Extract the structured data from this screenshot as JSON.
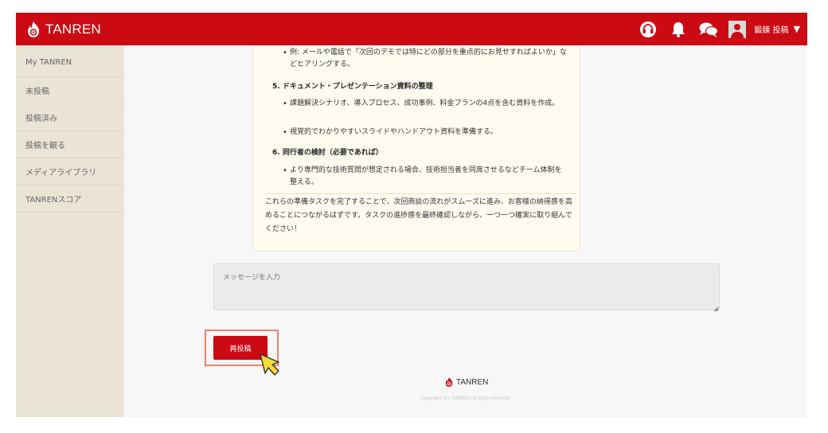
{
  "header": {
    "brand": "TANREN",
    "username": "鍛錬 投稿",
    "caret": "▼",
    "icons": [
      "headset-icon",
      "bell-icon",
      "chat-icon",
      "user-avatar-icon"
    ],
    "color": "#cc0a14"
  },
  "sidebar": {
    "items": [
      {
        "label": "My TANREN"
      },
      {
        "label": "未投稿"
      },
      {
        "label": "投稿済み"
      },
      {
        "label": "投稿を観る"
      },
      {
        "label": "メディアライブラリ"
      },
      {
        "label": "TANRENスコア"
      }
    ]
  },
  "chat": {
    "bullet1": "例: メールや電話で「次回のデモでは特にどの部分を重点的にお見せすればよいか」などヒアリングする。",
    "heading5": "5. ドキュメント・プレゼンテーション資料の整理",
    "bullet2": "課題解決シナリオ、導入プロセス、成功事例、料金プランの4点を含む資料を作成。",
    "bullet3": "視覚的でわかりやすいスライドやハンドアウト資料を準備する。",
    "heading6": "6. 同行者の検討（必要であれば）",
    "bullet4": "より専門的な技術質問が想定される場合、技術担当者を同席させるなどチーム体制を整える。",
    "summary": "これらの準備タスクを完了することで、次回商談の流れがスムーズに進み、お客様の納得感を高めることにつながるはずです。タスクの進捗感を最終確認しながら、一つ一つ確実に取り組んでください！"
  },
  "input": {
    "placeholder": "メッセージを入力"
  },
  "actions": {
    "repost_label": "再投稿"
  },
  "footer": {
    "brand": "TANREN",
    "copyright": "Copyright (C) TANREN All rights reserved."
  }
}
